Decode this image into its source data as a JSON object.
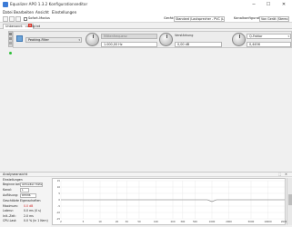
{
  "window": {
    "title": "Equalizer APO 1.3.2 Konfigurationseditor",
    "minimize": "─",
    "maximize": "☐",
    "close": "✕"
  },
  "menu": [
    "Datei",
    "Bearbeiten",
    "Ansicht",
    "Einstellungen"
  ],
  "toolbar": {
    "instant_mode_label": "Sofort-Modus",
    "device_label": "Gerät:",
    "device_value": "Standard (Lautsprecher - PVC (Larsen)",
    "channel_config_label": "Kanalkonfiguration:",
    "channel_config_value": "Von Gerät (Stereo)"
  },
  "tab": {
    "label": "Unbenannt · config.txt",
    "close": "✕"
  },
  "filter": {
    "type_value": "Peaking-Filter",
    "frequency_label": "Mittenfrequenz",
    "frequency_value": "1.000,00 Hz",
    "gain_label": "Verstärkung",
    "gain_value": "0,00 dB",
    "q_label": "Q-Faktor",
    "q_value": "0,4456"
  },
  "analysis": {
    "title": "Analyseansicht",
    "pin": "⬚",
    "close": "✕",
    "settings_heading": "Einstellungen",
    "start_at_label": "Beginne bei:",
    "start_at_value": "Aktuellen Datei",
    "channel_label": "Kanal:",
    "channel_value": "L",
    "resolution_label": "Auflösung:",
    "resolution_value": "65536",
    "properties_heading": "Geschätzte Eigenschaften",
    "peak_label": "Maximum:",
    "peak_value": "0.0 dB",
    "latency_label": "Latenz:",
    "latency_value": "0.0 ms (0 s)",
    "init_label": "Init.-Zeit:",
    "init_value": "2.0 ms",
    "cpu_label": "CPU-Last:",
    "cpu_value": "0.0 % (in 1 Kern)"
  },
  "graph": {
    "y_ticks": [
      "15",
      "10",
      "5",
      "0",
      "-5",
      "-10",
      "-15"
    ],
    "x_ticks": [
      "2",
      "5",
      "10",
      "20",
      "30",
      "50",
      "100",
      "200",
      "300",
      "500",
      "1000",
      "2000",
      "5000",
      "10000",
      "20000"
    ]
  },
  "colors": {
    "led": "#2fbf3a",
    "peak_value": "#cc2222",
    "tab_close": "#d9362b",
    "response_curve": "#707070"
  }
}
